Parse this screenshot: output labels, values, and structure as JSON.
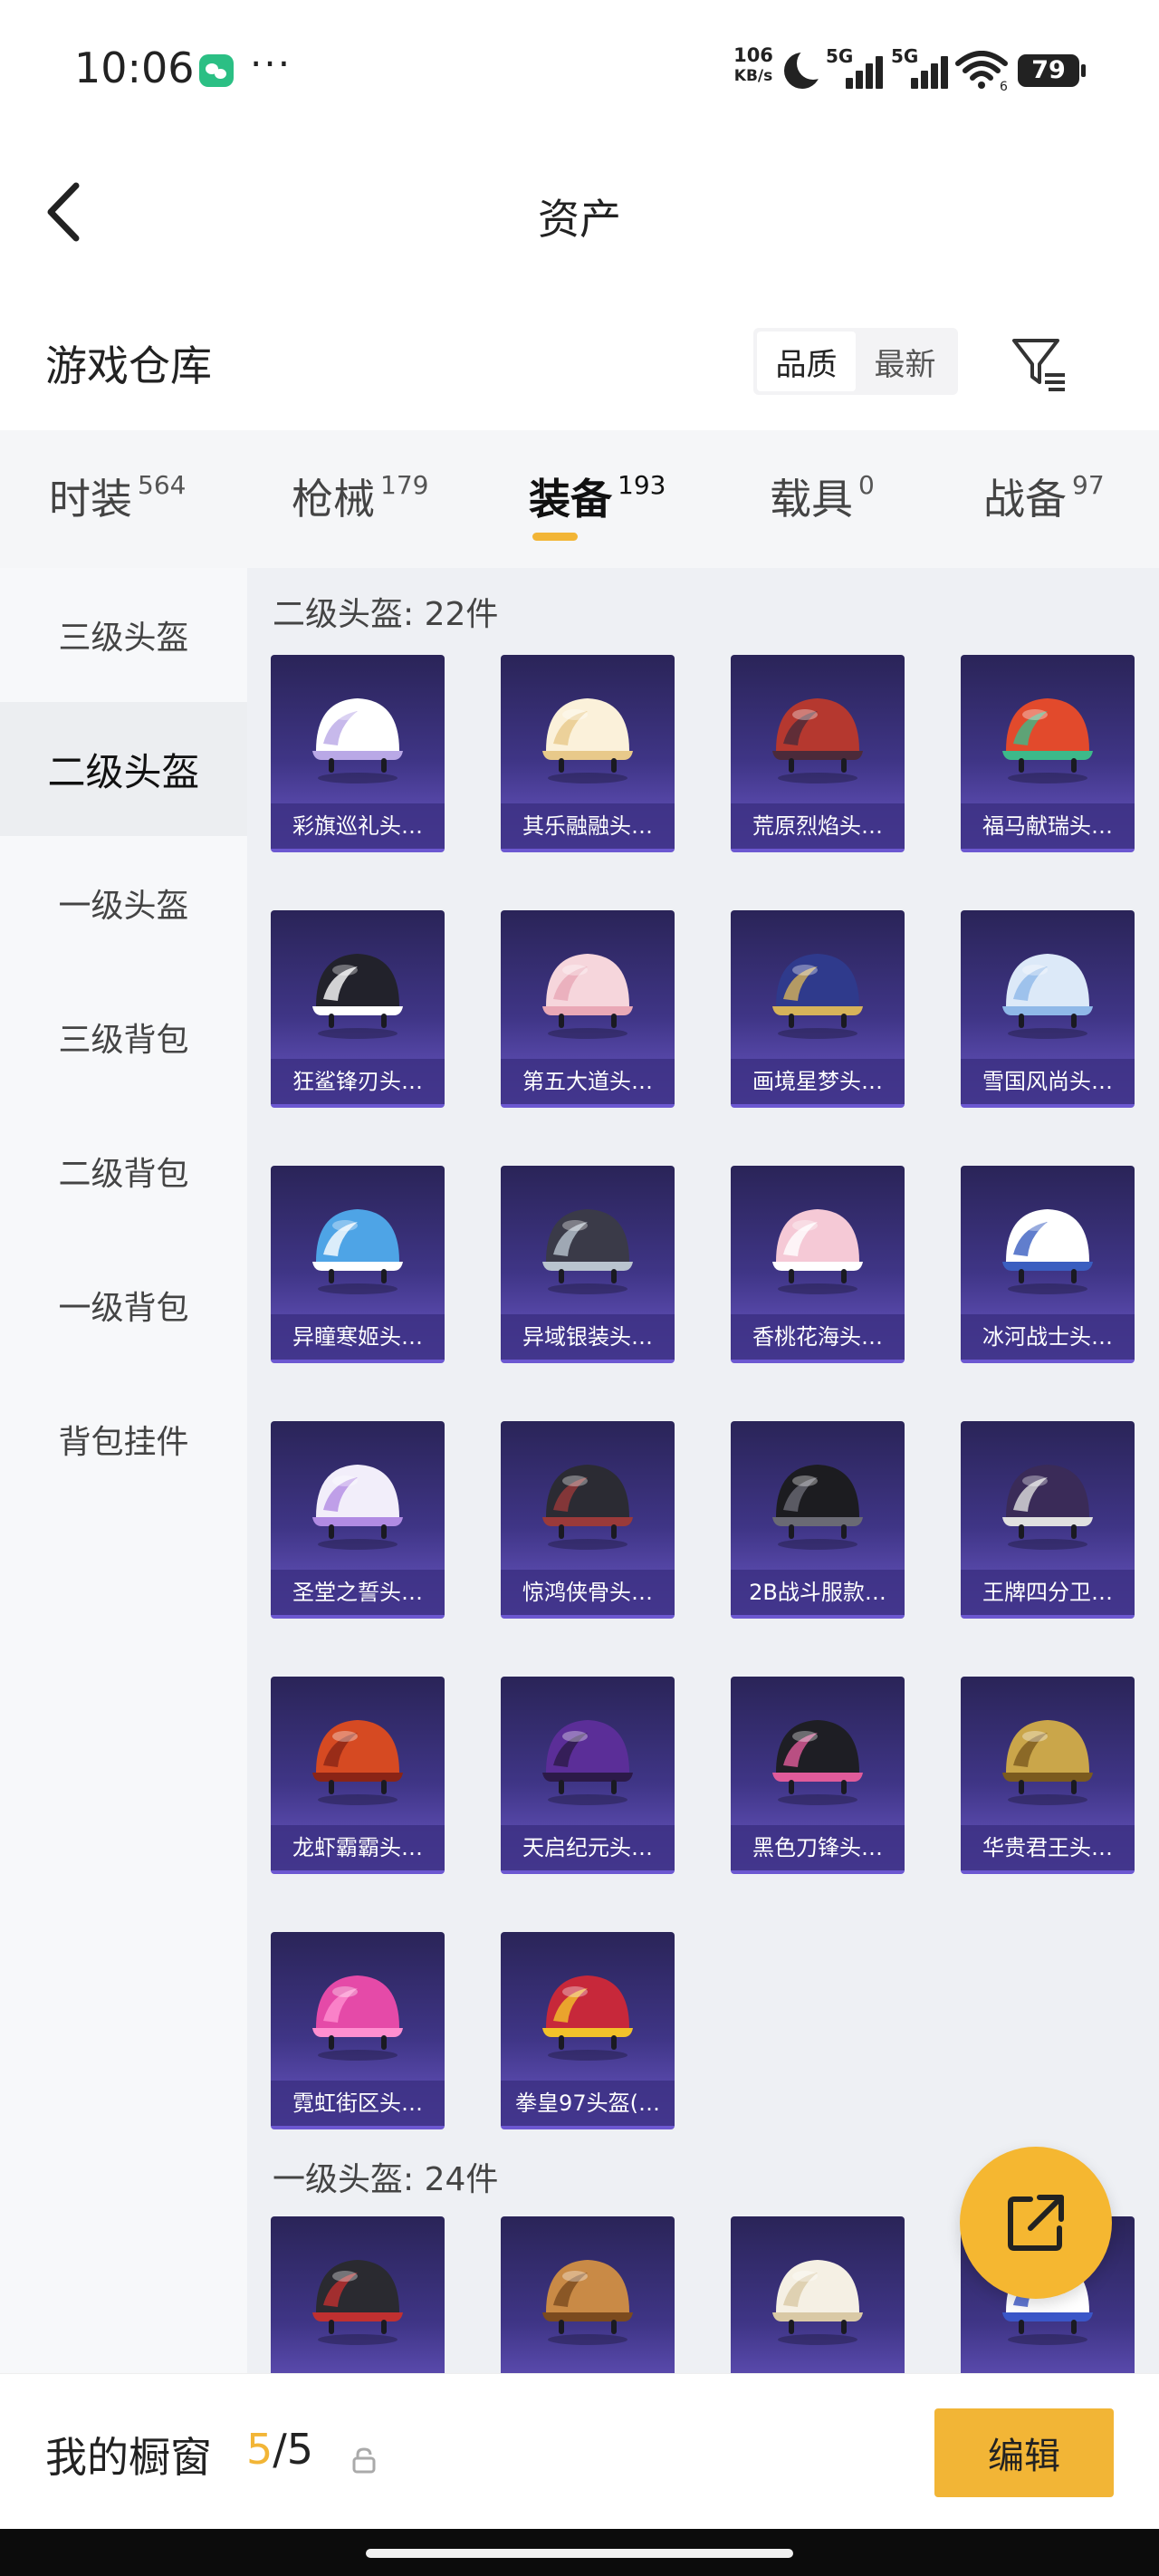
{
  "status_bar": {
    "time": "10:06",
    "net_speed_value": "106",
    "net_speed_unit": "KB/s",
    "sim1": "5G",
    "sim2": "5G",
    "wifi_badge": "6",
    "battery": "79"
  },
  "header": {
    "title": "资产"
  },
  "section": {
    "title": "游戏仓库",
    "sort_options": [
      "品质",
      "最新"
    ],
    "sort_active": "品质"
  },
  "tabs": [
    {
      "label": "时装",
      "count": "564"
    },
    {
      "label": "枪械",
      "count": "179"
    },
    {
      "label": "装备",
      "count": "193"
    },
    {
      "label": "载具",
      "count": "0"
    },
    {
      "label": "战备",
      "count": "97"
    }
  ],
  "active_tab": "装备",
  "sidebar": {
    "items": [
      "三级头盔",
      "二级头盔",
      "一级头盔",
      "三级背包",
      "二级背包",
      "一级背包",
      "背包挂件"
    ],
    "active": "二级头盔"
  },
  "groups": [
    {
      "title": "二级头盔: 22件",
      "items": [
        {
          "name": "彩旗巡礼头…",
          "colors": [
            "#ffffff",
            "#b9a8e6"
          ]
        },
        {
          "name": "其乐融融头…",
          "colors": [
            "#fbf1da",
            "#e8c98a"
          ]
        },
        {
          "name": "荒原烈焰头…",
          "colors": [
            "#b5382f",
            "#4b2a3a"
          ]
        },
        {
          "name": "福马献瑞头…",
          "colors": [
            "#e24a2c",
            "#3db98a"
          ]
        },
        {
          "name": "狂鲨锋刃头…",
          "colors": [
            "#22222b",
            "#ffffff"
          ]
        },
        {
          "name": "第五大道头…",
          "colors": [
            "#f6d6dc",
            "#e9a8b6"
          ]
        },
        {
          "name": "画境星梦头…",
          "colors": [
            "#2f3a8c",
            "#d6b35a"
          ]
        },
        {
          "name": "雪国风尚头…",
          "colors": [
            "#dce9f8",
            "#8fb8e8"
          ]
        },
        {
          "name": "异瞳寒姬头…",
          "colors": [
            "#4ea4e6",
            "#ffffff"
          ]
        },
        {
          "name": "异域银装头…",
          "colors": [
            "#3a3a48",
            "#b9c4cf"
          ]
        },
        {
          "name": "香桃花海头…",
          "colors": [
            "#f5c9d6",
            "#ffffff"
          ]
        },
        {
          "name": "冰河战士头…",
          "colors": [
            "#ffffff",
            "#3a5ec0"
          ]
        },
        {
          "name": "圣堂之誓头…",
          "colors": [
            "#f2eefa",
            "#b18be3"
          ]
        },
        {
          "name": "惊鸿侠骨头…",
          "colors": [
            "#2b2b33",
            "#9a3a3a"
          ]
        },
        {
          "name": "2B战斗服款…",
          "colors": [
            "#1c1c20",
            "#6a6a74"
          ]
        },
        {
          "name": "王牌四分卫…",
          "colors": [
            "#3a2b58",
            "#e0e0e0"
          ]
        },
        {
          "name": "龙虾霸霸头…",
          "colors": [
            "#d64a22",
            "#8a2416"
          ]
        },
        {
          "name": "天启纪元头…",
          "colors": [
            "#5b2e98",
            "#2c1a48"
          ]
        },
        {
          "name": "黑色刀锋头…",
          "colors": [
            "#1e1e24",
            "#e05b9a"
          ]
        },
        {
          "name": "华贵君王头…",
          "colors": [
            "#caa64a",
            "#7b5a1e"
          ]
        },
        {
          "name": "霓虹街区头…",
          "colors": [
            "#e54aa8",
            "#ff8fd0"
          ]
        },
        {
          "name": "拳皇97头盔(…",
          "colors": [
            "#c7283a",
            "#f2c22a"
          ]
        }
      ]
    },
    {
      "title": "一级头盔: 24件",
      "items": [
        {
          "name": "",
          "colors": [
            "#2a2a30",
            "#c03030"
          ]
        },
        {
          "name": "",
          "colors": [
            "#c98a46",
            "#7b4a1e"
          ]
        },
        {
          "name": "",
          "colors": [
            "#f5f0e4",
            "#d9c9a5"
          ]
        },
        {
          "name": "",
          "colors": [
            "#ffffff",
            "#3a56c8"
          ]
        }
      ]
    }
  ],
  "bottom": {
    "window_label": "我的橱窗",
    "window_current": "5",
    "window_total": "/5",
    "edit_label": "编辑"
  },
  "accent_color": "#f2b536"
}
